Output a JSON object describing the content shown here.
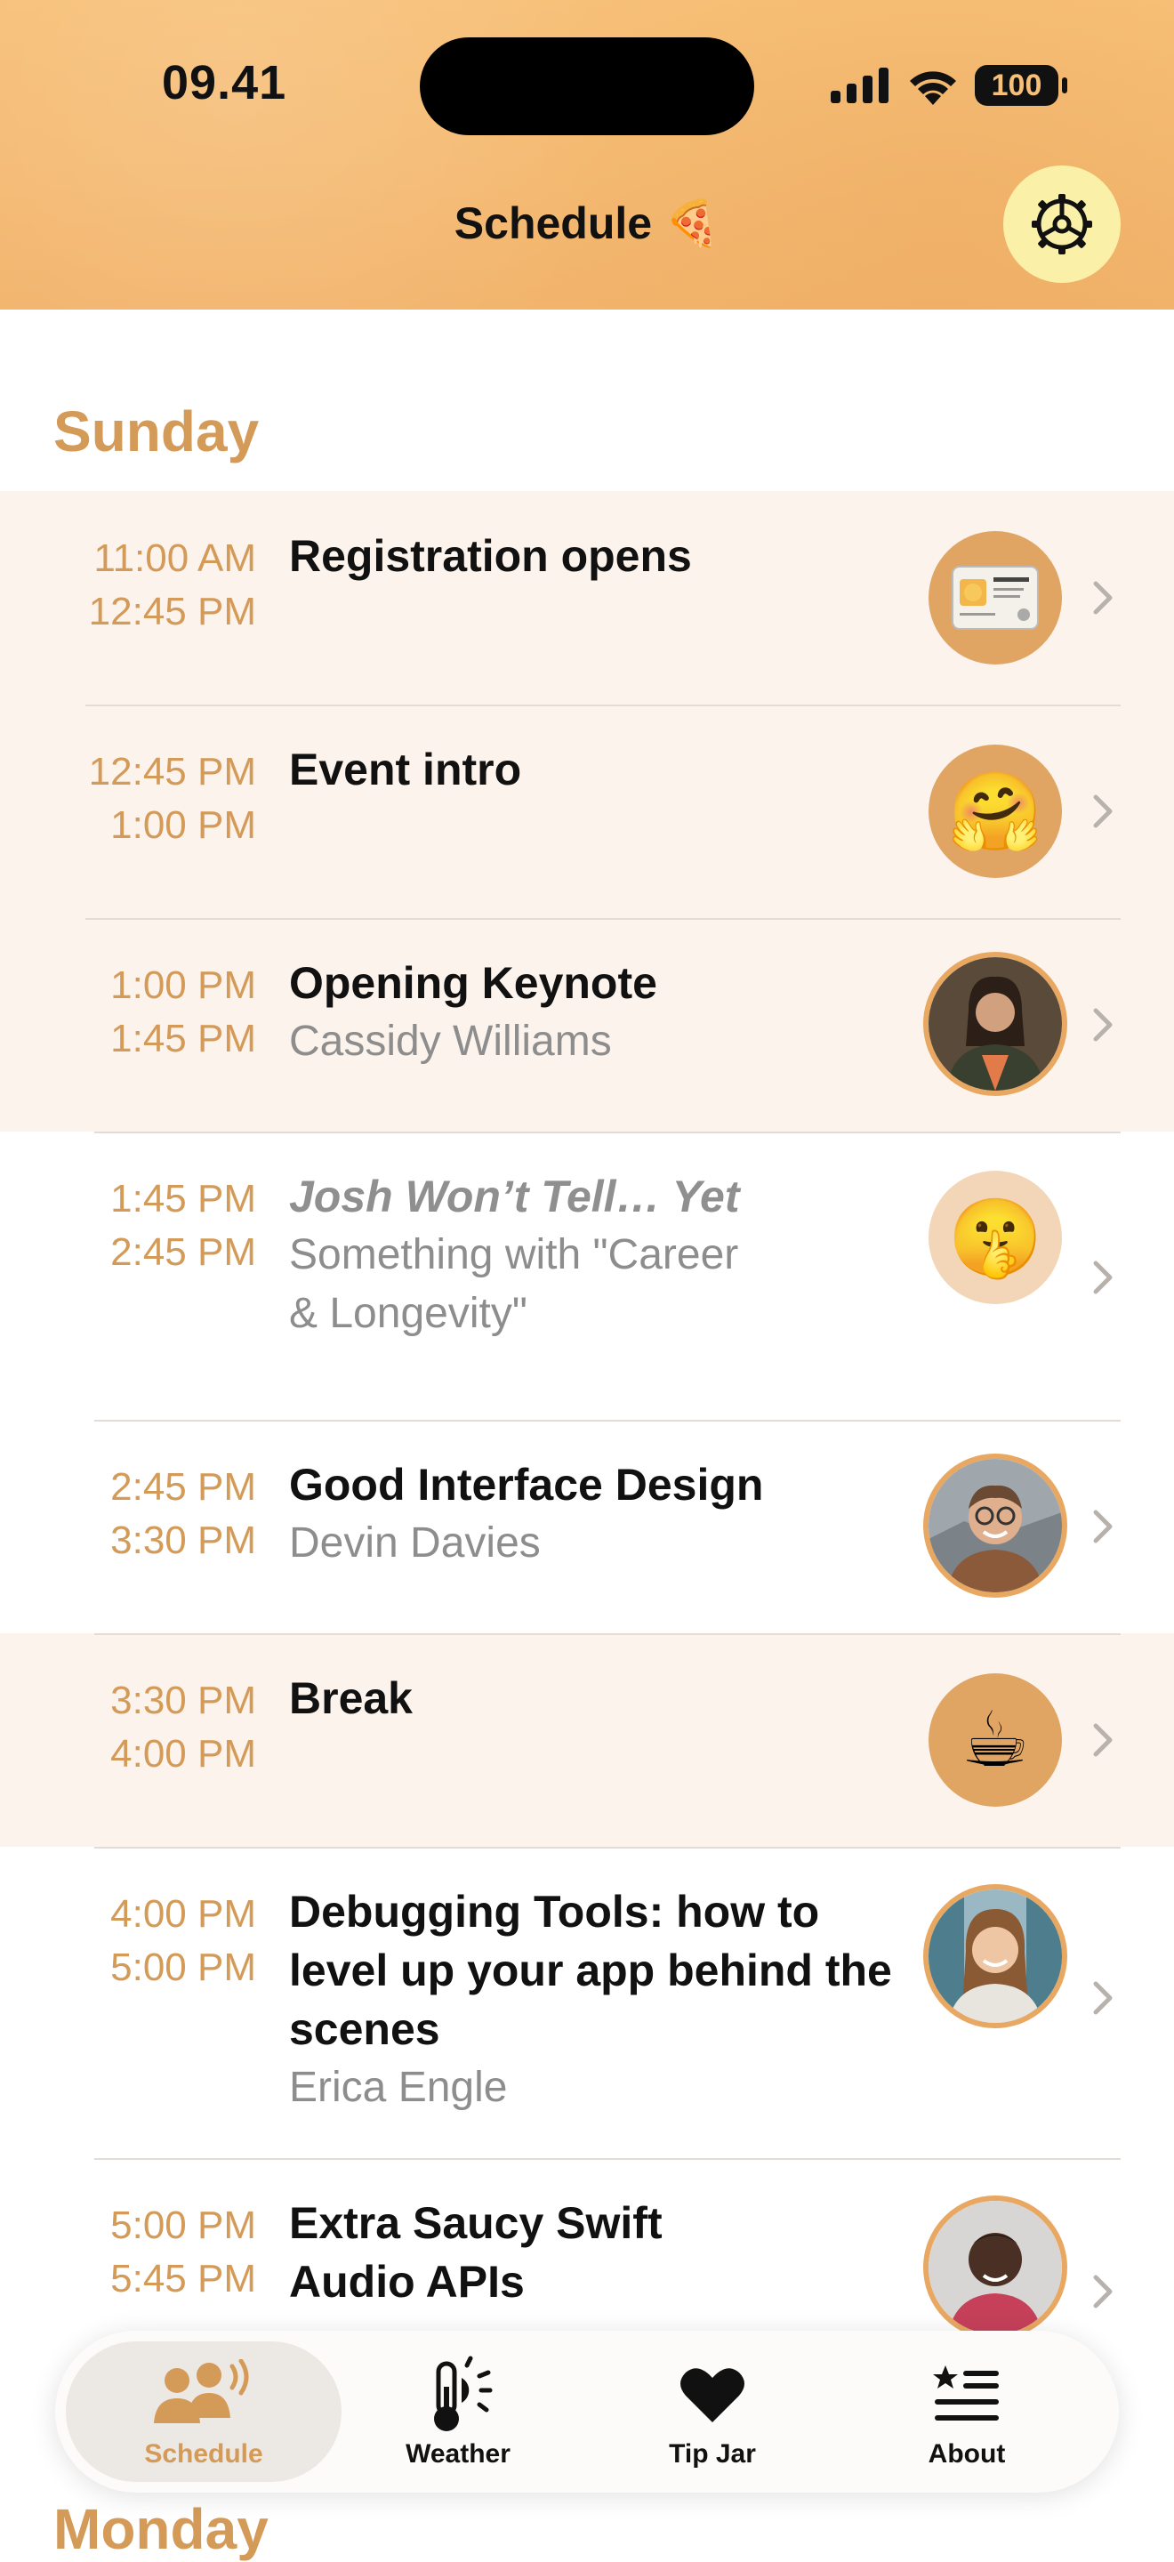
{
  "status_bar": {
    "time": "09.41",
    "battery": "100"
  },
  "nav": {
    "title": "Schedule 🍕"
  },
  "sections": [
    {
      "title": "Sunday"
    },
    {
      "title": "Monday"
    }
  ],
  "sessions": [
    {
      "start": "11:00 AM",
      "end": "12:45 PM",
      "title": "Registration opens",
      "speaker": "",
      "avatar_icon": "id-card-cat-emoji",
      "highlighted": true
    },
    {
      "start": "12:45 PM",
      "end": "1:00 PM",
      "title": "Event intro",
      "speaker": "",
      "avatar_icon": "hugging-face-emoji",
      "highlighted": true
    },
    {
      "start": "1:00 PM",
      "end": "1:45 PM",
      "title": "Opening Keynote",
      "speaker": "Cassidy Williams",
      "avatar_icon": "speaker-photo",
      "highlighted": true
    },
    {
      "start": "1:45 PM",
      "end": "2:45 PM",
      "title": "Josh Won’t Tell… Yet",
      "speaker_line1": "Something with \"Career",
      "speaker_line2": "& Longevity\"",
      "avatar_icon": "shushing-face-emoji",
      "highlighted": false
    },
    {
      "start": "2:45 PM",
      "end": "3:30 PM",
      "title": "Good Interface Design",
      "speaker": "Devin Davies",
      "avatar_icon": "speaker-photo",
      "highlighted": false
    },
    {
      "start": "3:30 PM",
      "end": "4:00 PM",
      "title": "Break",
      "speaker": "",
      "avatar_icon": "coffee-emoji",
      "highlighted": true
    },
    {
      "start": "4:00 PM",
      "end": "5:00 PM",
      "title_line1": "Debugging Tools: how to",
      "title_line2": "level up your app behind the",
      "title_line3": "scenes",
      "speaker": "Erica Engle",
      "avatar_icon": "speaker-photo",
      "highlighted": false
    },
    {
      "start": "5:00 PM",
      "end": "5:45 PM",
      "title_line1": "Extra Saucy Swift",
      "title_line2": "Audio APIs",
      "speaker": "",
      "avatar_icon": "speaker-photo",
      "highlighted": false
    }
  ],
  "emoji": {
    "hug": "🤗",
    "shush": "🤫",
    "coffee": "☕"
  },
  "tabs": [
    {
      "label": "Schedule",
      "icon": "people-broadcast-icon",
      "active": true
    },
    {
      "label": "Weather",
      "icon": "thermometer-sun-icon",
      "active": false
    },
    {
      "label": "Tip Jar",
      "icon": "heart-icon",
      "active": false
    },
    {
      "label": "About",
      "icon": "star-list-icon",
      "active": false
    }
  ],
  "colors": {
    "accent": "#d49a57",
    "header": "#f4b86f",
    "row_highlight": "#fcf3ec",
    "settings_bg": "#fbf0a8"
  }
}
